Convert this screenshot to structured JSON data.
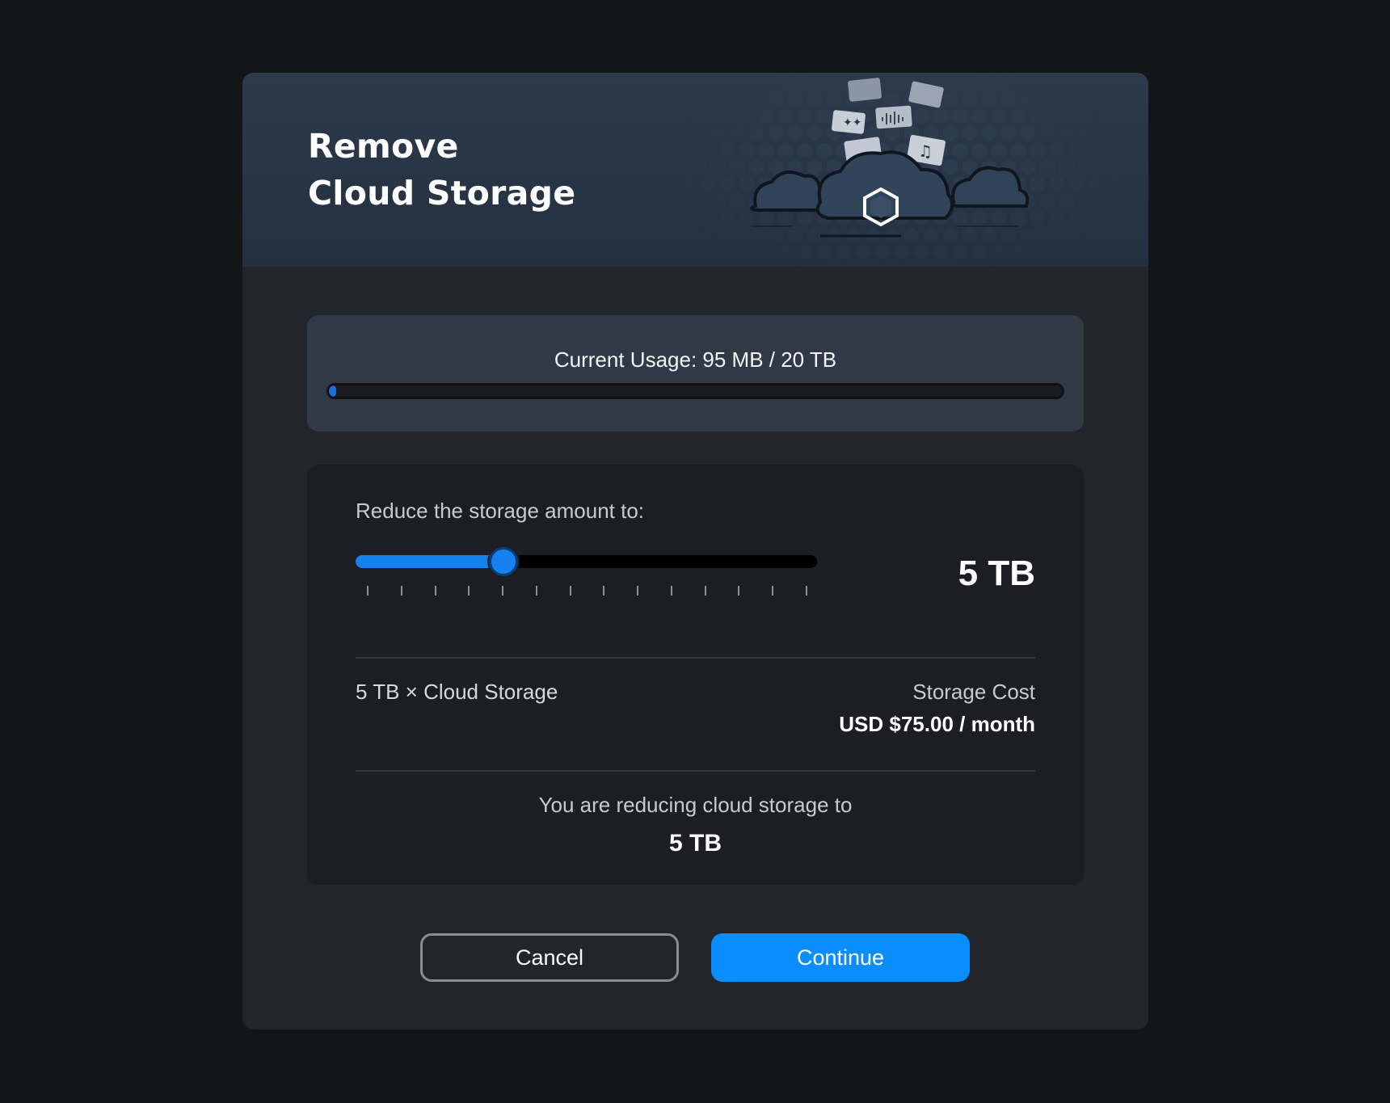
{
  "dialog": {
    "title_line1": "Remove",
    "title_line2": "Cloud Storage"
  },
  "usage": {
    "text": "Current Usage: 95 MB / 20 TB",
    "used_fraction": 0.005
  },
  "reduce": {
    "label": "Reduce the storage amount to:",
    "slider_value_fraction": 0.32,
    "tick_count": 14,
    "selected_value": "5 TB",
    "line_item": "5 TB × Cloud Storage",
    "cost_label": "Storage Cost",
    "cost_value": "USD $75.00 / month",
    "summary_text": "You are reducing cloud storage to",
    "summary_value": "5 TB"
  },
  "buttons": {
    "cancel": "Cancel",
    "continue": "Continue"
  },
  "colors": {
    "accent": "#0a8dff",
    "slider_fill": "#1682f0",
    "background": "#141518",
    "panel": "#22252b"
  },
  "icons": {
    "header_illustration": "cloud-storage-illustration",
    "center_icon": "hexagon-logo-icon"
  }
}
